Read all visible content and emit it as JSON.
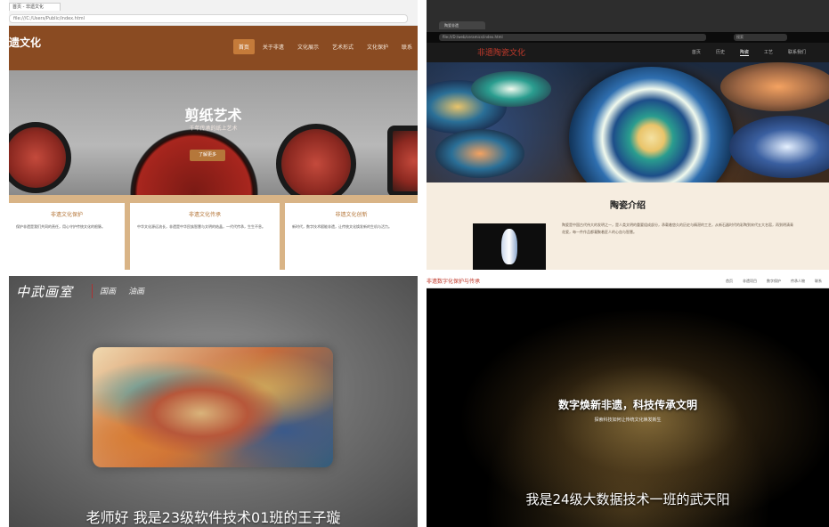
{
  "panel1": {
    "tab_title": "首页 - 非遗文化",
    "url": "file:///C:/Users/Public/index.html",
    "logo": "遗文化",
    "nav": [
      "首页",
      "关于非遗",
      "文化展示",
      "艺术形式",
      "文化保护",
      "联系"
    ],
    "hero_title": "剪纸艺术",
    "hero_sub": "千年传承的纸上艺术",
    "hero_button": "了解更多",
    "cards": [
      {
        "title": "非遗文化保护",
        "text": "保护非遗是我们共同的责任，用心守护传统文化的根脉。"
      },
      {
        "title": "非遗文化传承",
        "text": "中华文化源远流长，非遗是中华民族智慧与文明的结晶，一代代传承，生生不息。"
      },
      {
        "title": "非遗文化创新",
        "text": "新时代，数字技术赋能非遗，让传统文化焕发新的生机与活力。"
      }
    ]
  },
  "panel2": {
    "tab_title": "陶瓷非遗",
    "url": "file:///D:/web/ceramics/index.html",
    "search": "搜索",
    "logo": "非遗陶瓷文化",
    "nav": [
      "首页",
      "历史",
      "陶瓷",
      "工艺",
      "联系我们"
    ],
    "active_nav_index": 2,
    "section_title": "陶瓷介绍",
    "section_text": "陶瓷是中国古代伟大的发明之一，是人类文明的重要组成部分，承载着悠久的历史与精湛的工艺，从新石器时代的彩陶到宋代五大名窑，再到明清青花瓷，每一件作品都凝聚着匠人的心血与智慧。"
  },
  "panel3": {
    "logo": "中武画室",
    "nav": [
      "国画",
      "油画"
    ],
    "caption": "老师好 我是23级软件技术01班的王子璇"
  },
  "panel4": {
    "logo": "非遗数字化保护与传承",
    "nav": [
      "首页",
      "非遗项目",
      "数字保护",
      "传承人物",
      "联系"
    ],
    "title": "数字焕新非遗，科技传承文明",
    "subtitle": "探索科技如何让传统文化焕发新生",
    "caption": "我是24级大数据技术一班的武天阳"
  },
  "colors": {
    "brand_brown": "#8a4b22",
    "accent_tan": "#d9b486",
    "ceramic_red": "#c0392b"
  }
}
